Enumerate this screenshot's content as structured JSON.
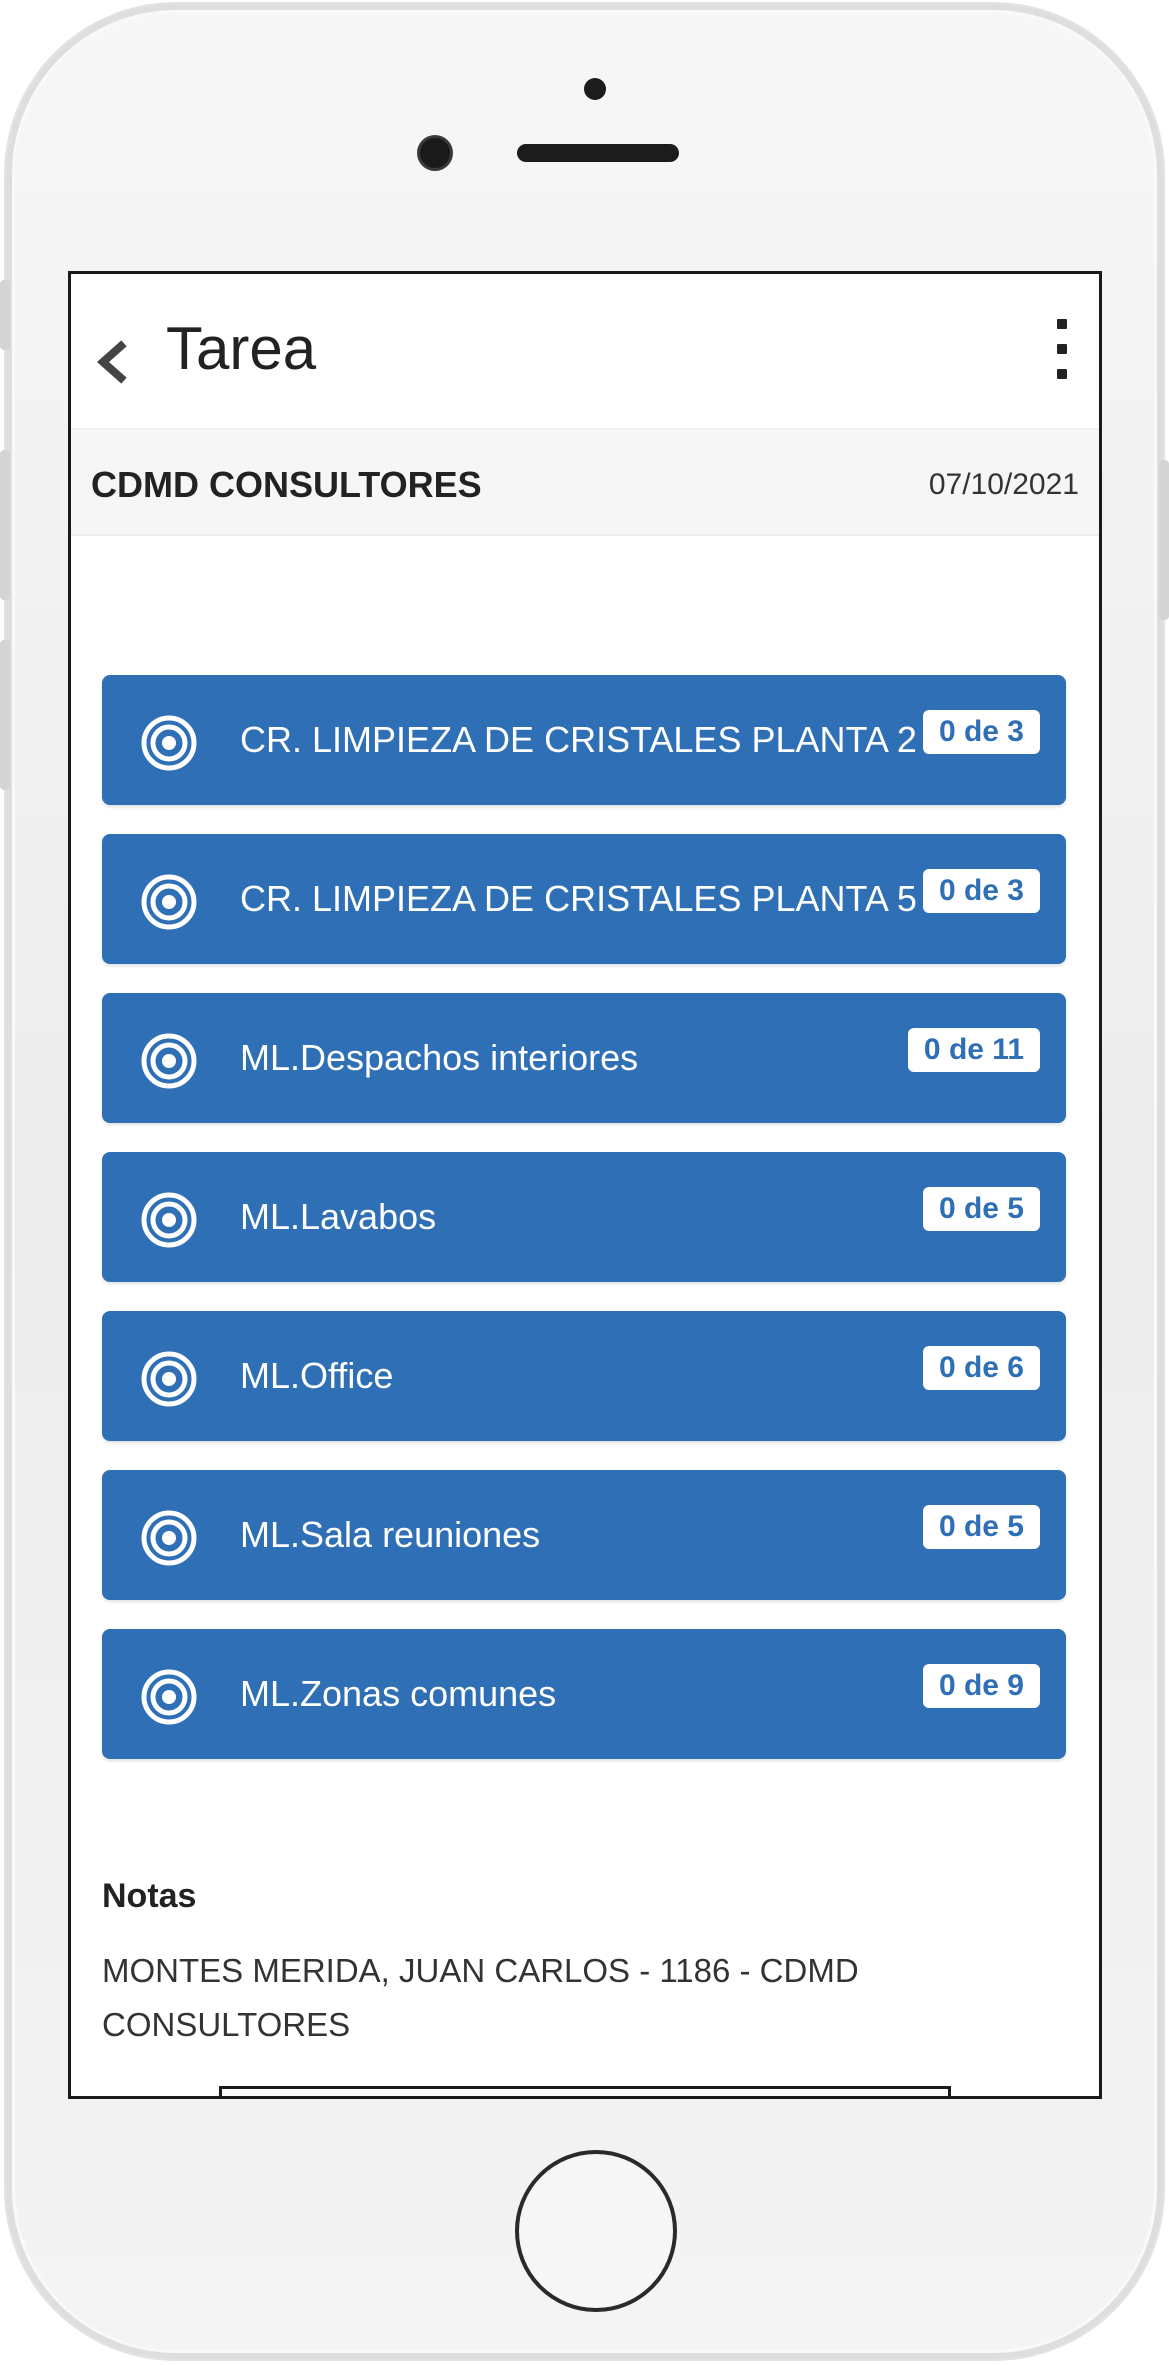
{
  "app": {
    "title": "Tarea"
  },
  "subheader": {
    "company": "CDMD CONSULTORES",
    "date": "07/10/2021"
  },
  "tasks": [
    {
      "label": "CR. LIMPIEZA DE CRISTALES PLANTA 2",
      "badge": "0 de 3"
    },
    {
      "label": "CR. LIMPIEZA DE CRISTALES PLANTA 5",
      "badge": "0 de 3"
    },
    {
      "label": "ML.Despachos interiores",
      "badge": "0 de 11"
    },
    {
      "label": "ML.Lavabos",
      "badge": "0 de 5"
    },
    {
      "label": "ML.Office",
      "badge": "0 de 6"
    },
    {
      "label": "ML.Sala reuniones",
      "badge": "0 de 5"
    },
    {
      "label": "ML.Zonas comunes",
      "badge": "0 de 9"
    }
  ],
  "notes": {
    "title": "Notas",
    "text": "MONTES MERIDA, JUAN CARLOS - 1186 - CDMD CONSULTORES"
  },
  "icons": {
    "back": "chevron-left-icon",
    "more": "more-vertical-icon",
    "task": "target-icon"
  },
  "colors": {
    "accent": "#2f6fb5",
    "badge_text": "#2f6fb5"
  }
}
